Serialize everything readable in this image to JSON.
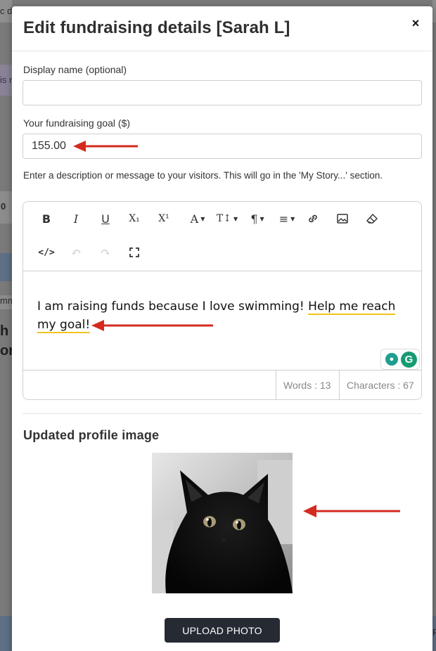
{
  "modal": {
    "title": "Edit fundraising details [Sarah L]",
    "close_label": "×"
  },
  "form": {
    "display_name": {
      "label": "Display name (optional)",
      "value": "",
      "placeholder": ""
    },
    "goal": {
      "label": "Your fundraising goal ($)",
      "value": "155.00"
    },
    "description_label": "Enter a description or message to your visitors. This will go in the 'My Story...' section."
  },
  "editor": {
    "toolbar": [
      {
        "name": "bold",
        "glyph": "B"
      },
      {
        "name": "italic",
        "glyph": "I"
      },
      {
        "name": "underline",
        "glyph": "U"
      },
      {
        "name": "subscript",
        "glyph": "X₁"
      },
      {
        "name": "superscript",
        "glyph": "X¹"
      },
      {
        "name": "font-color",
        "glyph": "A"
      },
      {
        "name": "font-size",
        "glyph": "T↕"
      },
      {
        "name": "paragraph",
        "glyph": "¶"
      },
      {
        "name": "align",
        "glyph": "≡"
      },
      {
        "name": "link",
        "glyph": "🔗"
      },
      {
        "name": "image",
        "glyph": "▣"
      },
      {
        "name": "clear-format",
        "glyph": "⌫"
      },
      {
        "name": "code-view",
        "glyph": "</>"
      },
      {
        "name": "undo",
        "glyph": "↶"
      },
      {
        "name": "redo",
        "glyph": "↷"
      },
      {
        "name": "fullscreen",
        "glyph": "⛶"
      }
    ],
    "text_part1": "I am raising funds because I love swimming! ",
    "text_part2": "Help me reach my goal!",
    "words": "Words : 13",
    "characters": "Characters : 67",
    "grammarly_letter": "G"
  },
  "profile": {
    "title": "Updated profile image",
    "upload_label": "UPLOAD PHOTO"
  },
  "background": {
    "frag1": "c de",
    "frag2": "is r",
    "frag3": "0",
    "frag4": "mm",
    "frag5": "h",
    "frag6": "or",
    "frag7": "F"
  },
  "colors": {
    "arrow": "#d42b1e",
    "button": "#252a33",
    "underline": "#f0c41b"
  }
}
